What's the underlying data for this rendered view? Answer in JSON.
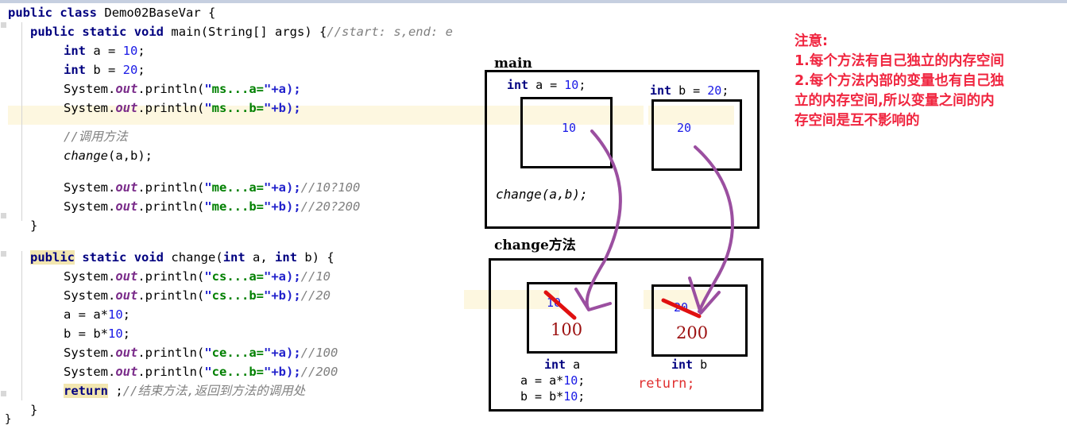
{
  "editor": {
    "language": "java",
    "class_name": "Demo02BaseVar",
    "lines": [
      {
        "n": 1,
        "text": "public class Demo02BaseVar {"
      },
      {
        "n": 2,
        "text": "    public static void main(String[] args) {//start: s,end: e"
      },
      {
        "n": 3,
        "text": "        int a = 10;"
      },
      {
        "n": 4,
        "text": "        int b = 20;"
      },
      {
        "n": 5,
        "text": "        System.out.println(\"ms...a=\"+a);"
      },
      {
        "n": 6,
        "text": "        System.out.println(\"ms...b=\"+b);"
      },
      {
        "n": 7,
        "text": ""
      },
      {
        "n": 8,
        "text": "        //调用方法"
      },
      {
        "n": 9,
        "text": "        change(a,b);"
      },
      {
        "n": 10,
        "text": ""
      },
      {
        "n": 11,
        "text": "        System.out.println(\"me...a=\"+a);//10?100"
      },
      {
        "n": 12,
        "text": "        System.out.println(\"me...b=\"+b);//20?200"
      },
      {
        "n": 13,
        "text": "    }"
      },
      {
        "n": 14,
        "text": ""
      },
      {
        "n": 15,
        "text": "    public static void change(int a, int b) {"
      },
      {
        "n": 16,
        "text": "        System.out.println(\"cs...a=\"+a);//10"
      },
      {
        "n": 17,
        "text": "        System.out.println(\"cs...b=\"+b);//20"
      },
      {
        "n": 18,
        "text": "        a = a*10;"
      },
      {
        "n": 19,
        "text": "        b = b*10;"
      },
      {
        "n": 20,
        "text": "        System.out.println(\"ce...a=\"+a);//100"
      },
      {
        "n": 21,
        "text": "        System.out.println(\"ce...b=\"+b);//200"
      },
      {
        "n": 22,
        "text": "        return ;//结束方法,返回到方法的调用处"
      },
      {
        "n": 23,
        "text": "    }"
      },
      {
        "n": 24,
        "text": "}"
      }
    ],
    "tokens": {
      "kw_public": "public",
      "kw_class": "class",
      "kw_static": "static",
      "kw_void": "void",
      "kw_int": "int",
      "kw_return": "return",
      "ident_class": "Demo02BaseVar",
      "ident_main": "main",
      "ident_change": "change",
      "sig_main": "(String[] args) {",
      "sig_change": "(",
      "comment_main": "//start: s,end: e",
      "comment_call": "//调用方法",
      "comment_me_a": "//10?100",
      "comment_me_b": "//20?200",
      "comment_cs_a": "//10",
      "comment_cs_b": "//20",
      "comment_ce_a": "//100",
      "comment_ce_b": "//200",
      "comment_return": "//结束方法,返回到方法的调用处",
      "sysout": "System.",
      "out": "out",
      "println": ".println(",
      "s_ms_a": "ms...a=",
      "s_ms_b": "ms...b=",
      "s_me_a": "me...a=",
      "s_me_b": "me...b=",
      "s_cs_a": "cs...a=",
      "s_cs_b": "cs...b=",
      "s_ce_a": "ce...a=",
      "s_ce_b": "ce...b=",
      "tail_a": "\"+a);",
      "tail_b": "\"+b);",
      "decl_a": " a = ",
      "decl_b": " b = ",
      "v10": "10",
      "v20": "20",
      "semi": ";",
      "call_change": "change",
      "call_args": "(a,b);",
      "assign_a": "a = a*",
      "assign_b": "b = b*",
      "brace_close": "}",
      "brace_close_inner": "    }",
      "change_params_a": " a, ",
      "change_params_b": " b) {",
      "return_semi": " ;"
    }
  },
  "diagram": {
    "main_frame": {
      "label": "main",
      "decl_a": "int a = 10;",
      "decl_a_kw": "int",
      "decl_a_rest": " a = ",
      "decl_a_val": "10",
      "decl_a_semi": ";",
      "decl_b_kw": "int",
      "decl_b_rest": " b = ",
      "decl_b_val": "20",
      "decl_b_semi": ";",
      "box_a_value": "10",
      "box_b_value": "20",
      "call_line": "change(a,b);"
    },
    "change_frame": {
      "label": "change方法",
      "box_a_old_value": "10",
      "box_a_new_value": "100",
      "box_b_old_value": "20",
      "box_b_new_value": "200",
      "under_a_kw": "int",
      "under_a_name": " a",
      "under_a_line1": "a = a*10;",
      "under_a_line1_pre": "a = a*",
      "under_a_line1_num": "10",
      "under_a_line1_semi": ";",
      "under_a_line2_pre": "b = b*",
      "under_a_line2_num": "10",
      "under_a_line2_semi": ";",
      "under_b_kw": "int",
      "under_b_name": " b",
      "return_text": "return;"
    },
    "colors": {
      "arrow": "#9b4fa0",
      "strike": "#e01010",
      "new_value": "#9c1010",
      "old_value": "#1a1ae6",
      "return": "#e03030",
      "box_border": "#000000"
    }
  },
  "note": {
    "title": "注意:",
    "items": [
      "1.每个方法有自己独立的内存空间",
      "2.每个方法内部的变量也有自己独",
      "立的内存空间,所以变量之间的内",
      "存空间是互不影响的"
    ],
    "color": "#f0253f"
  }
}
